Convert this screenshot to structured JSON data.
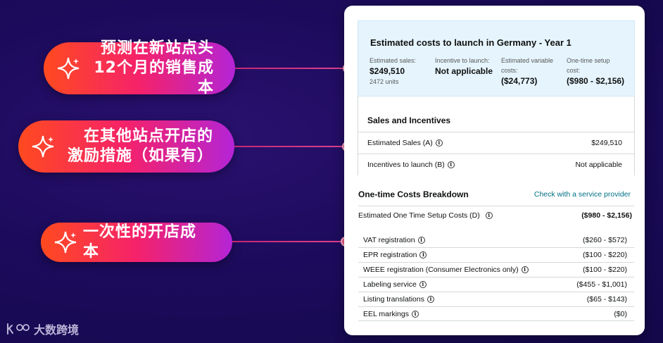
{
  "callouts": [
    {
      "line1": "预测在新站点头",
      "line2": "12个月的销售成本"
    },
    {
      "line1": "在其他站点开店的",
      "line2": "激励措施（如果有）"
    },
    {
      "line1": "一次性的开店成本",
      "line2": ""
    }
  ],
  "estimate": {
    "title": "Estimated costs to launch in Germany - Year 1",
    "sales_label": "Estimated sales:",
    "sales_value": "$249,510",
    "sales_units": "2472 units",
    "incentive_label": "Incentive to launch:",
    "incentive_value": "Not applicable",
    "variable_label_1": "Estimated variable",
    "variable_label_2": "costs:",
    "variable_value": "($24,773)",
    "setup_label_1": "One-time setup",
    "setup_label_2": "cost:",
    "setup_value": "($980 - $2,156)"
  },
  "sales_incentives": {
    "title": "Sales and Incentives",
    "rows": [
      {
        "label": "Estimated Sales (A)",
        "value": "$249,510"
      },
      {
        "label": "Incentives to launch (B)",
        "value": "Not applicable"
      }
    ]
  },
  "one_time": {
    "title": "One-time Costs Breakdown",
    "link": "Check with a service provider",
    "total_label": "Estimated One Time Setup Costs (D)",
    "total_value": "($980 - $2,156)",
    "rows": [
      {
        "label": "VAT registration",
        "value": "($260 - $572)"
      },
      {
        "label": "EPR registration",
        "value": "($100 - $220)"
      },
      {
        "label": "WEEE registration (Consumer Electronics only)",
        "value": "($100 - $220)"
      },
      {
        "label": "Labeling service",
        "value": "($455 - $1,001)"
      },
      {
        "label": "Listing translations",
        "value": "($65 - $143)"
      },
      {
        "label": "EEL markings",
        "value": "($0)"
      }
    ]
  },
  "info_glyph": "i",
  "brand": {
    "name": "大数跨境",
    "icon": "k100-logo-icon"
  },
  "colors": {
    "pill_start": "#ff4a1f",
    "pill_end": "#b424d6",
    "link": "#007185",
    "estimate_bg": "#e6f4fd"
  }
}
